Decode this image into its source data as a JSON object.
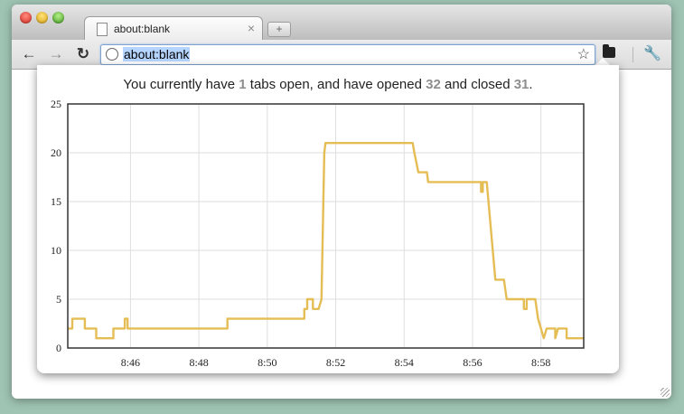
{
  "browser": {
    "tab": {
      "title": "about:blank",
      "close_glyph": "×"
    },
    "new_tab_glyph": "+",
    "nav": {
      "back": "←",
      "forward": "→",
      "reload": "↻"
    },
    "address": {
      "url": "about:blank"
    },
    "bookmark_glyph": "☆",
    "wrench_glyph": "🔧",
    "icons": [
      "back-icon",
      "forward-icon",
      "reload-icon",
      "globe-icon",
      "star-icon",
      "folder-icon",
      "wrench-icon"
    ]
  },
  "popup": {
    "text_1": "You currently have ",
    "open_count": "1",
    "text_2": " tabs open, and have opened ",
    "opened_count": "32",
    "text_3": " and closed ",
    "closed_count": "31",
    "text_4": ".",
    "count_color": "#8e8e8e"
  },
  "chart_data": {
    "type": "line",
    "title": "",
    "xlabel": "",
    "ylabel": "",
    "ylim": [
      0,
      25
    ],
    "yticks": [
      "0",
      "5",
      "10",
      "15",
      "20",
      "25"
    ],
    "xticks": [
      "8:46",
      "8:48",
      "8:50",
      "8:52",
      "8:54",
      "8:56",
      "8:58"
    ],
    "xlim": [
      "8:44:10",
      "8:59:15"
    ],
    "grid": true,
    "series": [
      {
        "name": "",
        "color": "#e5bd55",
        "points": [
          [
            "8:44:10",
            2
          ],
          [
            "8:44:18",
            2
          ],
          [
            "8:44:18",
            3
          ],
          [
            "8:44:40",
            3
          ],
          [
            "8:44:40",
            2
          ],
          [
            "8:45:00",
            2
          ],
          [
            "8:45:00",
            1
          ],
          [
            "8:45:30",
            1
          ],
          [
            "8:45:30",
            2
          ],
          [
            "8:45:50",
            2
          ],
          [
            "8:45:50",
            3
          ],
          [
            "8:45:55",
            3
          ],
          [
            "8:45:55",
            2
          ],
          [
            "8:48:50",
            2
          ],
          [
            "8:48:50",
            3
          ],
          [
            "8:51:05",
            3
          ],
          [
            "8:51:05",
            4
          ],
          [
            "8:51:10",
            4
          ],
          [
            "8:51:10",
            5
          ],
          [
            "8:51:20",
            5
          ],
          [
            "8:51:20",
            4
          ],
          [
            "8:51:30",
            4
          ],
          [
            "8:51:35",
            5
          ],
          [
            "8:51:40",
            20
          ],
          [
            "8:51:42",
            21
          ],
          [
            "8:54:15",
            21
          ],
          [
            "8:54:18",
            20
          ],
          [
            "8:54:25",
            18
          ],
          [
            "8:54:40",
            18
          ],
          [
            "8:54:42",
            17
          ],
          [
            "8:56:15",
            17
          ],
          [
            "8:56:15",
            16
          ],
          [
            "8:56:18",
            16
          ],
          [
            "8:56:18",
            17
          ],
          [
            "8:56:25",
            17
          ],
          [
            "8:56:40",
            7
          ],
          [
            "8:56:55",
            7
          ],
          [
            "8:57:00",
            5
          ],
          [
            "8:57:30",
            5
          ],
          [
            "8:57:30",
            4
          ],
          [
            "8:57:35",
            4
          ],
          [
            "8:57:35",
            5
          ],
          [
            "8:57:50",
            5
          ],
          [
            "8:57:55",
            3
          ],
          [
            "8:58:00",
            2
          ],
          [
            "8:58:05",
            1
          ],
          [
            "8:58:10",
            2
          ],
          [
            "8:58:25",
            2
          ],
          [
            "8:58:25",
            1
          ],
          [
            "8:58:30",
            2
          ],
          [
            "8:58:45",
            2
          ],
          [
            "8:58:45",
            1
          ],
          [
            "8:59:15",
            1
          ]
        ]
      }
    ]
  }
}
